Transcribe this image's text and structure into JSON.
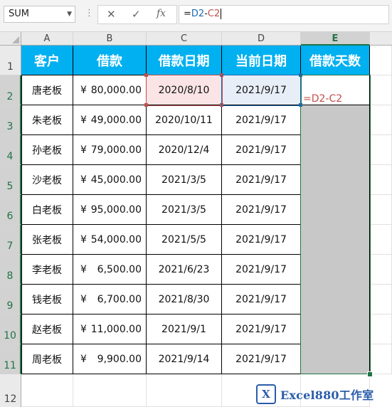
{
  "name_box": {
    "value": "SUM",
    "dropdown_icon": "chevron-down-icon"
  },
  "formula_buttons": {
    "more_icon": "vertical-dots-icon",
    "cancel_icon": "x-icon",
    "enter_icon": "checkmark-icon",
    "function_icon": "fx-icon",
    "function_label": "fx"
  },
  "formula_bar": {
    "prefix": "=",
    "ref1": "D2",
    "op": "-",
    "ref2": "C2"
  },
  "columns": [
    "A",
    "B",
    "C",
    "D",
    "E"
  ],
  "rows": [
    "1",
    "2",
    "3",
    "4",
    "5",
    "6",
    "7",
    "8",
    "9",
    "10",
    "11",
    "12"
  ],
  "table": {
    "headers": [
      "客户",
      "借款",
      "借款日期",
      "当前日期",
      "借款天数"
    ],
    "currency_symbol": "¥",
    "rows": [
      {
        "customer": "唐老板",
        "amount": "80,000.00",
        "loan_date": "2020/8/10",
        "current_date": "2021/9/17"
      },
      {
        "customer": "朱老板",
        "amount": "49,000.00",
        "loan_date": "2020/10/11",
        "current_date": "2021/9/17"
      },
      {
        "customer": "孙老板",
        "amount": "79,000.00",
        "loan_date": "2020/12/4",
        "current_date": "2021/9/17"
      },
      {
        "customer": "沙老板",
        "amount": "45,000.00",
        "loan_date": "2021/3/5",
        "current_date": "2021/9/17"
      },
      {
        "customer": "白老板",
        "amount": "95,000.00",
        "loan_date": "2021/3/5",
        "current_date": "2021/9/17"
      },
      {
        "customer": "张老板",
        "amount": "54,000.00",
        "loan_date": "2021/5/5",
        "current_date": "2021/9/17"
      },
      {
        "customer": "李老板",
        "amount": "6,500.00",
        "loan_date": "2021/6/23",
        "current_date": "2021/9/17"
      },
      {
        "customer": "钱老板",
        "amount": "6,700.00",
        "loan_date": "2021/8/30",
        "current_date": "2021/9/17"
      },
      {
        "customer": "赵老板",
        "amount": "11,000.00",
        "loan_date": "2021/9/1",
        "current_date": "2021/9/17"
      },
      {
        "customer": "周老板",
        "amount": "9,900.00",
        "loan_date": "2021/9/14",
        "current_date": "2021/9/17"
      }
    ]
  },
  "editing_cell": {
    "text": "=D2-C2"
  },
  "watermark": {
    "mark": "X",
    "text": "Excel880工作室"
  },
  "colors": {
    "header_fill": "#00b0f0",
    "selection": "#217346",
    "ref_red": "#c0504d",
    "ref_blue": "#1d6ab3",
    "selected_fill": "#c8c8c8"
  }
}
